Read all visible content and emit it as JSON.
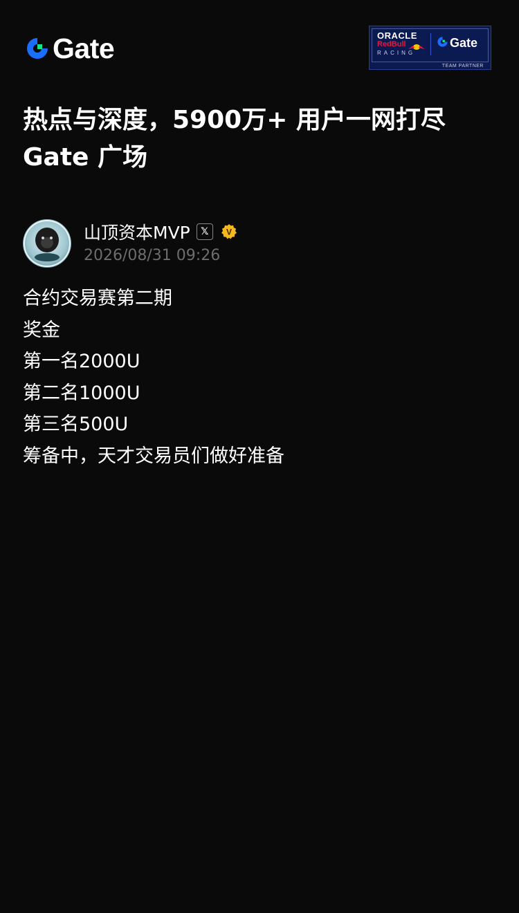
{
  "header": {
    "logo_text": "Gate",
    "partner_badge": {
      "oracle_text": "ORACLE",
      "redbull_text": "RedBull",
      "racing_text": "RACING",
      "gate_text": "Gate",
      "team_partner_text": "TEAM PARTNER"
    }
  },
  "headline": {
    "line1": "热点与深度，5900万+ 用户一网打尽",
    "line2": "Gate 广场"
  },
  "author": {
    "name": "山顶资本MVP",
    "x_badge": "𝕏",
    "verified_letter": "V",
    "time": "2026/08/31 09:26",
    "avatar_caption": "山顶资本"
  },
  "post": {
    "lines": [
      "合约交易赛第二期",
      "奖金",
      "第一名2000U",
      "第二名1000U",
      "第三名500U",
      "筹备中，天才交易员们做好准备"
    ]
  },
  "colors": {
    "background": "#0a0a0a",
    "gate_blue": "#1a6dff",
    "gate_green": "#17e58a",
    "verified_gold": "#f5b820",
    "muted_text": "#6d6d6d"
  },
  "icons": {
    "logo": "gate-logo-icon",
    "x": "x-twitter-icon",
    "verified": "verified-badge-icon"
  }
}
